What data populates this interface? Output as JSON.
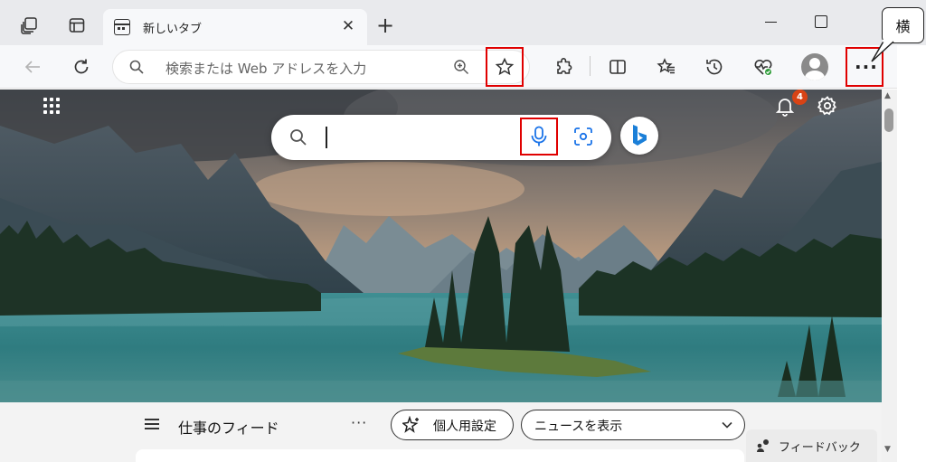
{
  "tab": {
    "title": "新しいタブ",
    "close": "✕"
  },
  "newtab": {
    "label": "+"
  },
  "address": {
    "placeholder": "検索または Web アドレスを入力"
  },
  "toolbar": {
    "more": "···"
  },
  "callout": {
    "text": "横"
  },
  "notifications": {
    "count": "4"
  },
  "feed": {
    "title": "仕事のフィード",
    "more": "···",
    "personalize": "個人用設定",
    "news_select": "ニュースを表示",
    "feedback": "フィードバック"
  },
  "colors": {
    "highlight": "#e00000",
    "tabbar": "#e9eaed",
    "toolbar": "#f7f8fa",
    "visual_search": "#1a73e8",
    "mic": "#1a73e8",
    "badge": "#d84315"
  },
  "icons": [
    "tab-actions-icon",
    "workspaces-icon",
    "back-icon",
    "refresh-icon",
    "search-icon",
    "zoom-icon",
    "favorite-star-icon",
    "extensions-icon",
    "split-screen-icon",
    "favorites-icon",
    "history-icon",
    "browser-essentials-icon",
    "profile-icon",
    "more-icon",
    "apps-grid-icon",
    "microphone-icon",
    "visual-search-icon",
    "bing-icon",
    "bell-icon",
    "gear-icon",
    "hamburger-icon",
    "sparkle-icon",
    "chevron-down-icon",
    "feedback-icon"
  ]
}
